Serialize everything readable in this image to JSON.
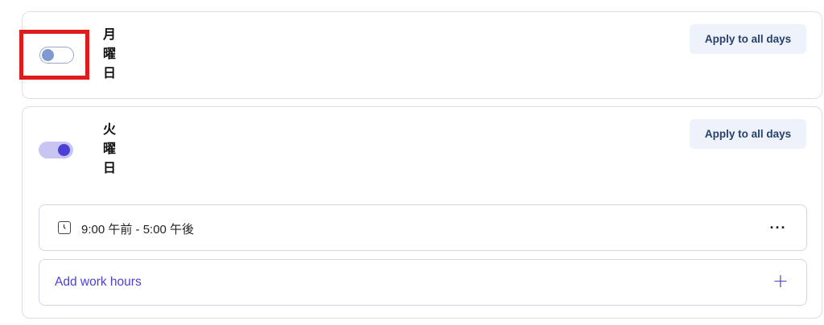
{
  "days": [
    {
      "label": "月曜日",
      "enabled": false,
      "apply_label": "Apply to all days"
    },
    {
      "label": "火曜日",
      "enabled": true,
      "apply_label": "Apply to all days",
      "time_slot": "9:00 午前 - 5:00 午後",
      "more_label": "···",
      "add_label": "Add work hours",
      "add_icon": "+"
    }
  ],
  "colors": {
    "accent": "#4b3fd6",
    "highlight": "#e01b1b",
    "apply_button_bg": "#eef3fb"
  }
}
